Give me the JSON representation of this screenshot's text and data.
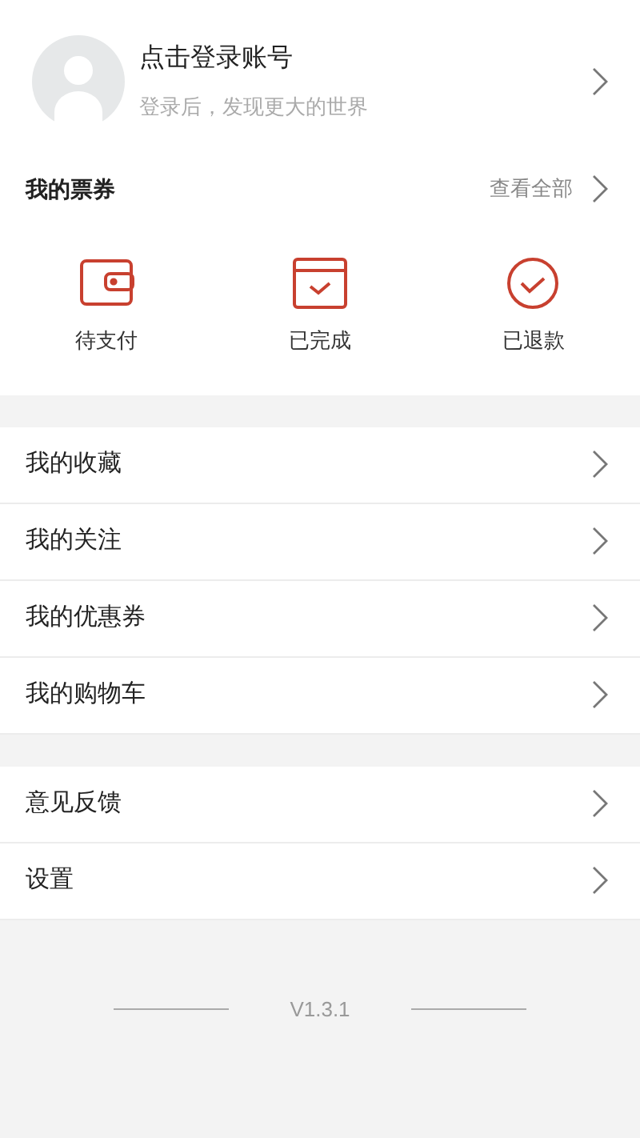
{
  "profile": {
    "title": "点击登录账号",
    "subtitle": "登录后，发现更大的世界"
  },
  "tickets": {
    "title": "我的票券",
    "view_all": "查看全部",
    "items": [
      {
        "kind": "wallet",
        "label": "待支付"
      },
      {
        "kind": "calendar",
        "label": "已完成"
      },
      {
        "kind": "circle",
        "label": "已退款"
      }
    ]
  },
  "menu_groups": [
    [
      {
        "label": "我的收藏"
      },
      {
        "label": "我的关注"
      },
      {
        "label": "我的优惠券"
      },
      {
        "label": "我的购物车"
      }
    ],
    [
      {
        "label": "意见反馈"
      },
      {
        "label": "设置"
      }
    ]
  ],
  "version": "V1.3.1"
}
